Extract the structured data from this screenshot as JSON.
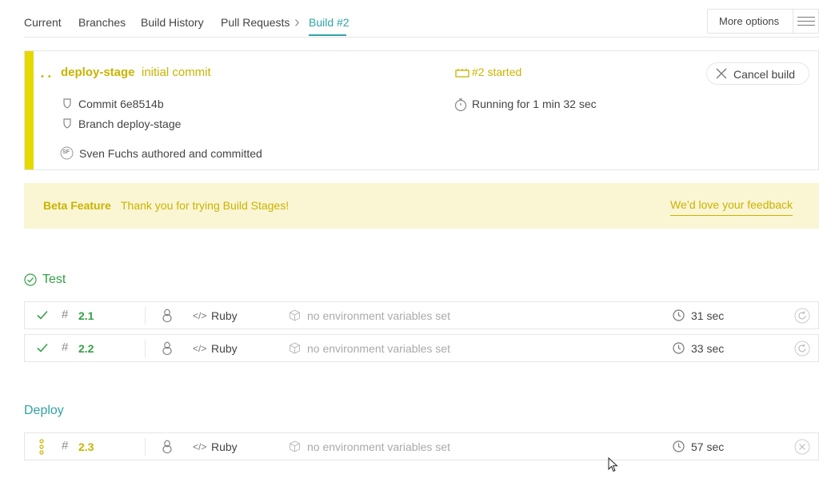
{
  "nav": {
    "items": [
      "Current",
      "Branches",
      "Build History",
      "Pull Requests"
    ],
    "active": "Build #2",
    "more_label": "More options"
  },
  "build": {
    "branch": "deploy-stage",
    "message": "initial commit",
    "number_status": "#2 started",
    "commit": "Commit 6e8514b",
    "branch_line": "Branch deploy-stage",
    "running": "Running for 1 min 32 sec",
    "author_initials": "SF",
    "author": "Sven Fuchs authored and committed",
    "cancel_label": "Cancel build"
  },
  "beta": {
    "label": "Beta Feature",
    "text": "Thank you for trying Build Stages!",
    "link": "We’d love your feedback"
  },
  "stages": [
    {
      "name": "Test",
      "jobs": [
        {
          "number": "2.1",
          "language": "Ruby",
          "env": "no environment variables set",
          "duration": "31 sec",
          "status": "passed"
        },
        {
          "number": "2.2",
          "language": "Ruby",
          "env": "no environment variables set",
          "duration": "33 sec",
          "status": "passed"
        }
      ]
    },
    {
      "name": "Deploy",
      "jobs": [
        {
          "number": "2.3",
          "language": "Ruby",
          "env": "no environment variables set",
          "duration": "57 sec",
          "status": "running"
        }
      ]
    }
  ],
  "colors": {
    "accent_teal": "#2fa3a3",
    "running_yellow": "#c9b400",
    "passed_green": "#35a047",
    "stripe_yellow": "#e5d900",
    "beta_bg": "#faf5d3"
  }
}
